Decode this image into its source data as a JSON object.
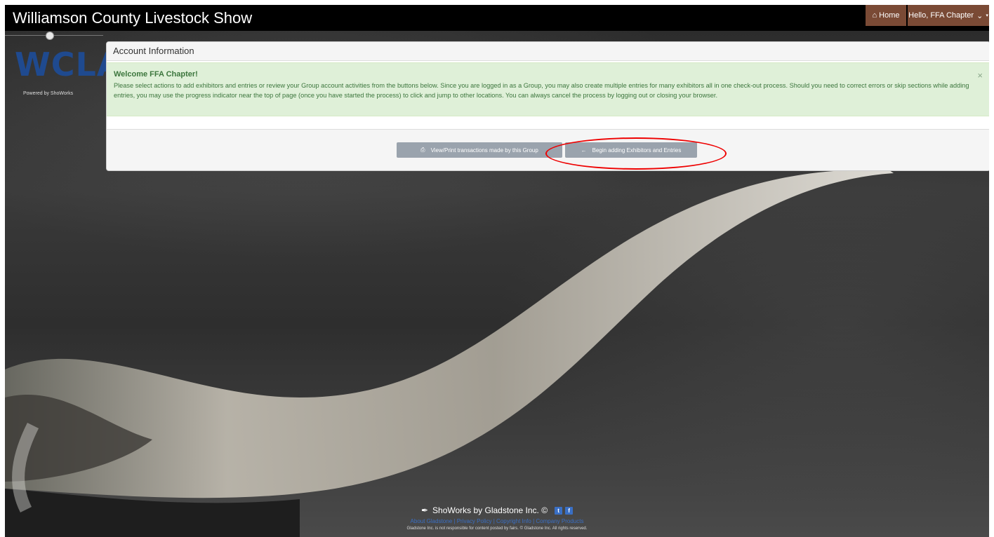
{
  "header": {
    "title": "Williamson County Livestock Show",
    "home_label": "Home",
    "user_label": "Hello, FFA Chapter",
    "accent": "#7a4a35"
  },
  "sidebar": {
    "logo_text": "WCLA",
    "powered_by": "Powered by ShoWorks"
  },
  "panel": {
    "heading": "Account Information",
    "alert_title": "Welcome FFA Chapter!",
    "alert_text": "Please select actions to add exhibitors and entries or review your Group account activities from the buttons below. Since you are logged in as a Group, you may also create multiple entries for many exhibitors all in one check-out process. Should you need to correct errors or skip sections while adding entries, you may use the progress indicator near the top of page (once you have started the process) to click and jump to other locations. You can always cancel the process by logging out or closing your browser.",
    "close_glyph": "×",
    "buttons": {
      "view_print": "View/Print transactions made by this Group",
      "begin_adding": "Begin adding Exhibitors and Entries"
    }
  },
  "footer": {
    "brand": "ShoWorks by Gladstone Inc. ©",
    "links": [
      "About Gladstone",
      "Privacy Policy",
      "Copyright Info",
      "Company Products"
    ],
    "disclaimer": "Gladstone Inc. is not responsible for content posted by fairs. © Gladstone Inc. All rights reserved."
  },
  "icons": [
    "home-icon",
    "chevron-down-icon",
    "print-icon",
    "arrow-left-icon",
    "feather-icon",
    "twitter-icon",
    "facebook-icon"
  ],
  "colors": {
    "alert_bg": "#dff0d8",
    "alert_text": "#3c763d",
    "button_bg": "#9aa3ad",
    "highlight": "#e00000",
    "link": "#3a6fc4"
  }
}
